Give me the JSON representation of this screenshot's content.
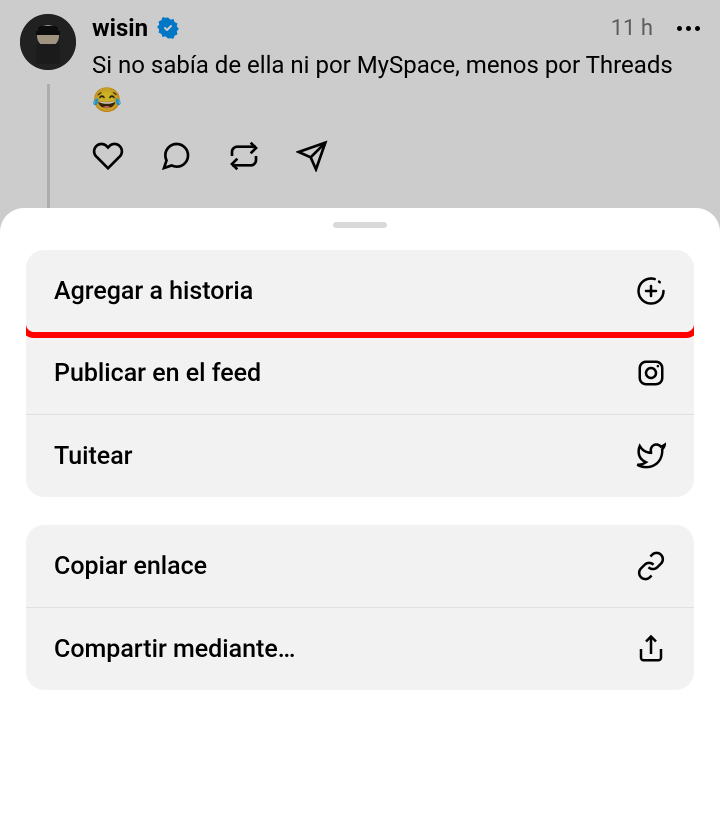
{
  "post": {
    "username": "wisin",
    "time": "11 h",
    "text": "Si no sabía de ella ni por MySpace, menos por Threads 😂"
  },
  "sheet": {
    "group1": {
      "add_to_story": "Agregar a historia",
      "publish_feed": "Publicar en el feed",
      "tweet": "Tuitear"
    },
    "group2": {
      "copy_link": "Copiar enlace",
      "share_via": "Compartir mediante…"
    }
  }
}
